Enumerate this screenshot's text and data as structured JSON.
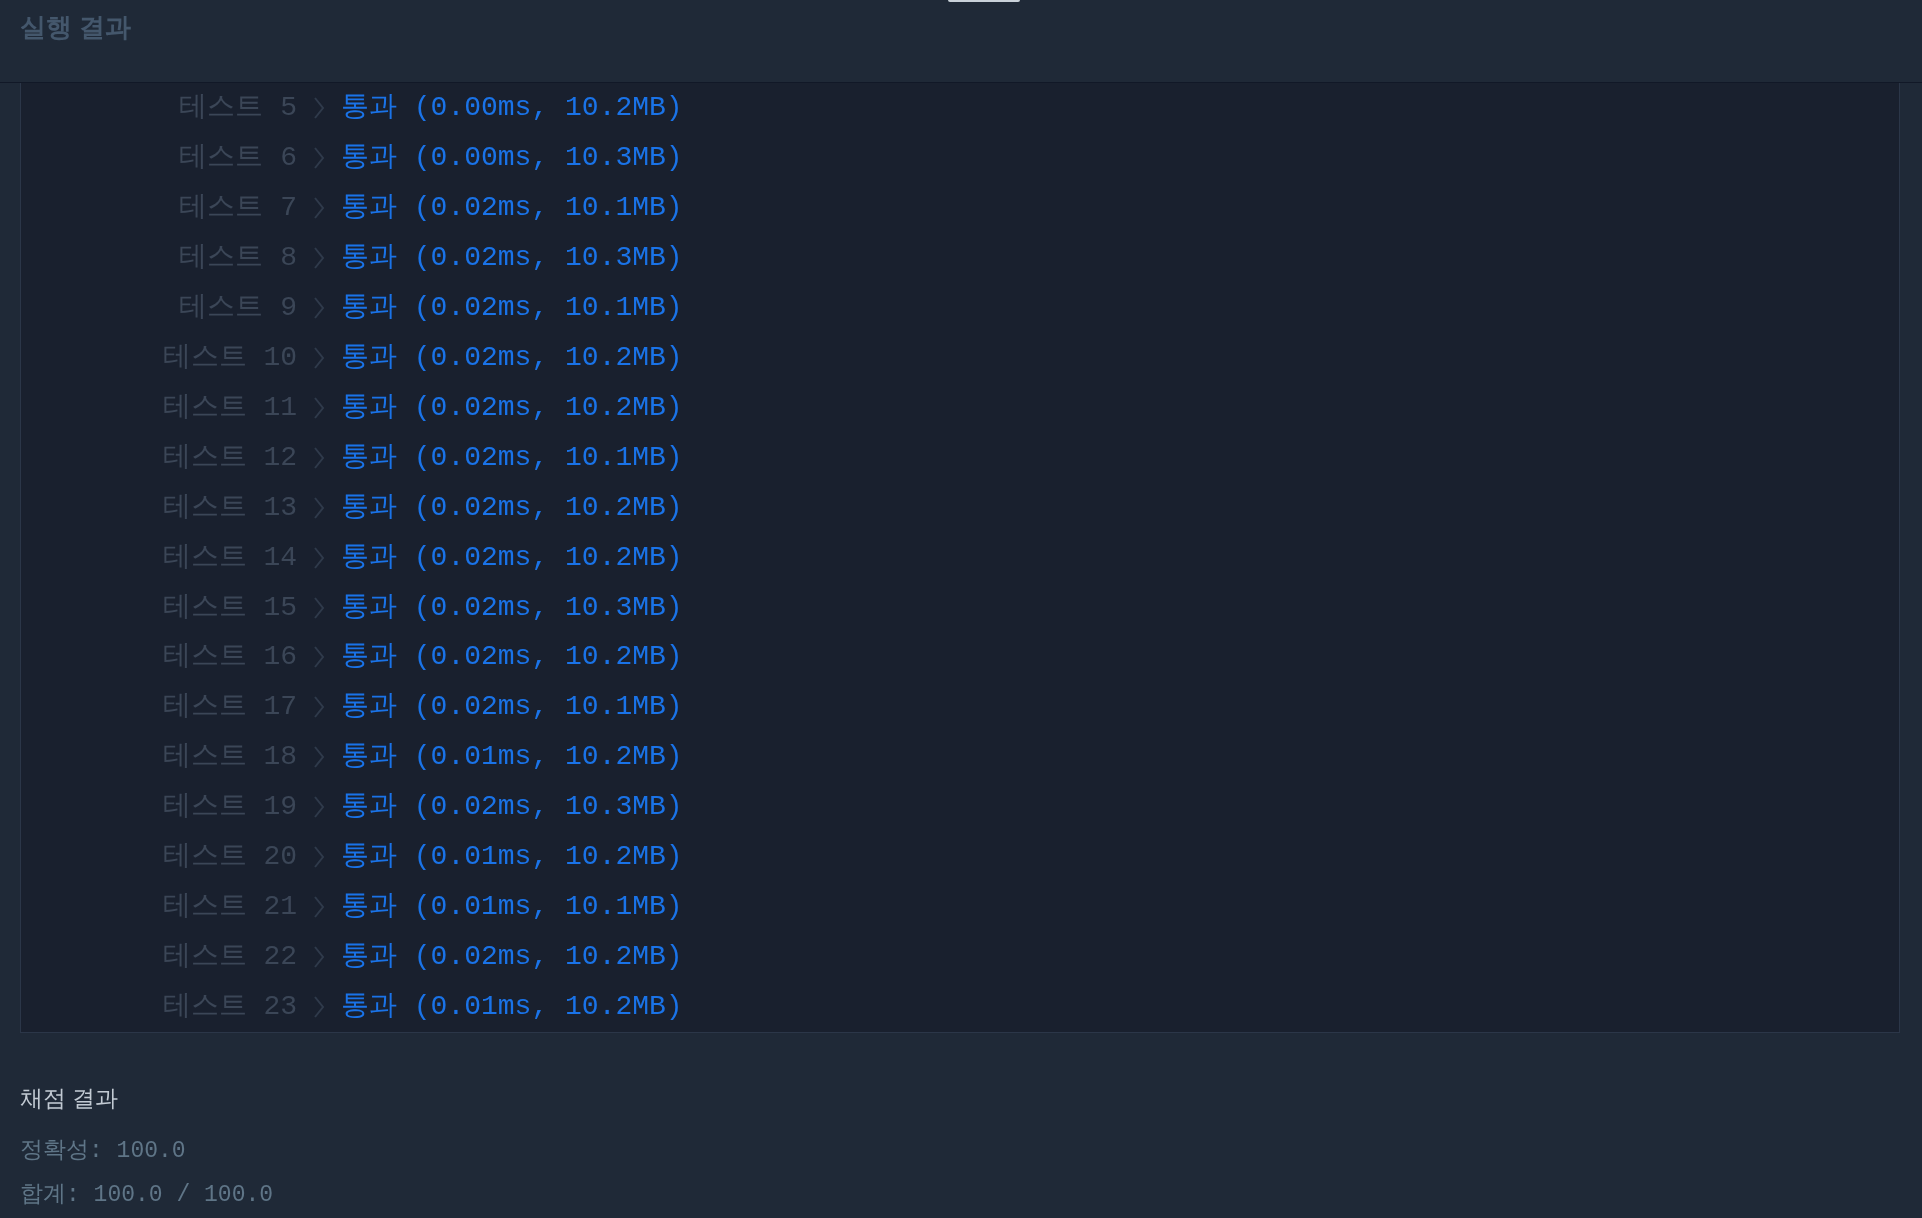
{
  "header": {
    "title": "실행 결과"
  },
  "console": {
    "rows": [
      {
        "label": "테스트 5",
        "result": "통과 (0.00ms, 10.2MB)"
      },
      {
        "label": "테스트 6",
        "result": "통과 (0.00ms, 10.3MB)"
      },
      {
        "label": "테스트 7",
        "result": "통과 (0.02ms, 10.1MB)"
      },
      {
        "label": "테스트 8",
        "result": "통과 (0.02ms, 10.3MB)"
      },
      {
        "label": "테스트 9",
        "result": "통과 (0.02ms, 10.1MB)"
      },
      {
        "label": "테스트 10",
        "result": "통과 (0.02ms, 10.2MB)"
      },
      {
        "label": "테스트 11",
        "result": "통과 (0.02ms, 10.2MB)"
      },
      {
        "label": "테스트 12",
        "result": "통과 (0.02ms, 10.1MB)"
      },
      {
        "label": "테스트 13",
        "result": "통과 (0.02ms, 10.2MB)"
      },
      {
        "label": "테스트 14",
        "result": "통과 (0.02ms, 10.2MB)"
      },
      {
        "label": "테스트 15",
        "result": "통과 (0.02ms, 10.3MB)"
      },
      {
        "label": "테스트 16",
        "result": "통과 (0.02ms, 10.2MB)"
      },
      {
        "label": "테스트 17",
        "result": "통과 (0.02ms, 10.1MB)"
      },
      {
        "label": "테스트 18",
        "result": "통과 (0.01ms, 10.2MB)"
      },
      {
        "label": "테스트 19",
        "result": "통과 (0.02ms, 10.3MB)"
      },
      {
        "label": "테스트 20",
        "result": "통과 (0.01ms, 10.2MB)"
      },
      {
        "label": "테스트 21",
        "result": "통과 (0.01ms, 10.1MB)"
      },
      {
        "label": "테스트 22",
        "result": "통과 (0.02ms, 10.2MB)"
      },
      {
        "label": "테스트 23",
        "result": "통과 (0.01ms, 10.2MB)"
      }
    ]
  },
  "grading": {
    "title": "채점 결과",
    "lines": [
      "정확성: 100.0",
      "합계: 100.0 / 100.0"
    ]
  }
}
